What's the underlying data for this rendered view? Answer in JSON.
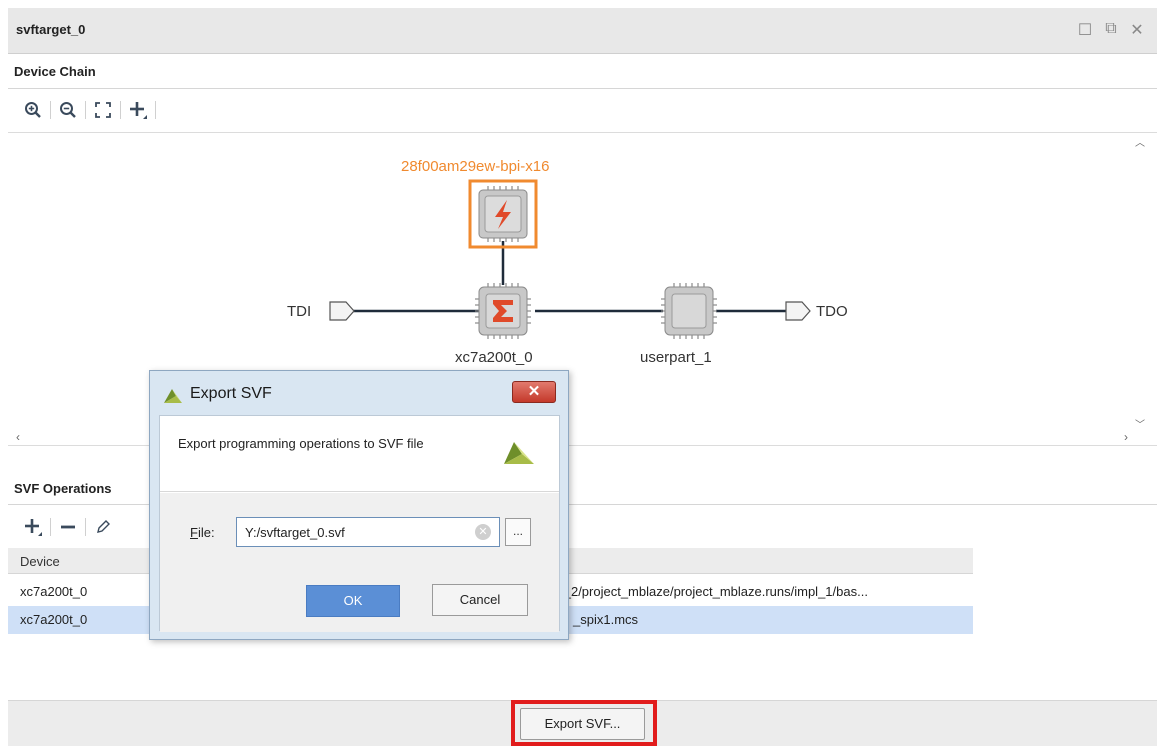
{
  "window": {
    "title": "svftarget_0",
    "controls": [
      "maximize-icon",
      "restore-icon",
      "close-icon"
    ]
  },
  "device_chain": {
    "section_label": "Device Chain",
    "toolbar": [
      "zoom-in-icon",
      "zoom-out-icon",
      "fit-icon",
      "add-icon"
    ],
    "tdi_label": "TDI",
    "tdo_label": "TDO",
    "flash_label": "28f00am29ew-bpi-x16",
    "fpga_label": "xc7a200t_0",
    "userpart_label": "userpart_1",
    "colors": {
      "flash_accent": "#f08a2f",
      "fpga_accent": "#e04a2a",
      "wire": "#1f2b3a"
    }
  },
  "svf_operations": {
    "section_label": "SVF Operations",
    "toolbar": [
      "add-icon",
      "remove-icon",
      "edit-icon"
    ],
    "columns": [
      "Device"
    ],
    "rows": [
      {
        "device": "xc7a200t_0",
        "file": "sh_2/project_mblaze/project_mblaze.runs/impl_1/bas...",
        "selected": false
      },
      {
        "device": "xc7a200t_0",
        "file": "_spix1.mcs",
        "selected": true
      }
    ]
  },
  "footer": {
    "export_label": "Export SVF..."
  },
  "dialog": {
    "title": "Export SVF",
    "close_label": "✕",
    "message": "Export programming operations to SVF file",
    "file_label_prefix": "F",
    "file_label_rest": "ile:",
    "file_value": "Y:/svftarget_0.svf",
    "browse_label": "...",
    "ok_label": "OK",
    "cancel_label": "Cancel"
  }
}
